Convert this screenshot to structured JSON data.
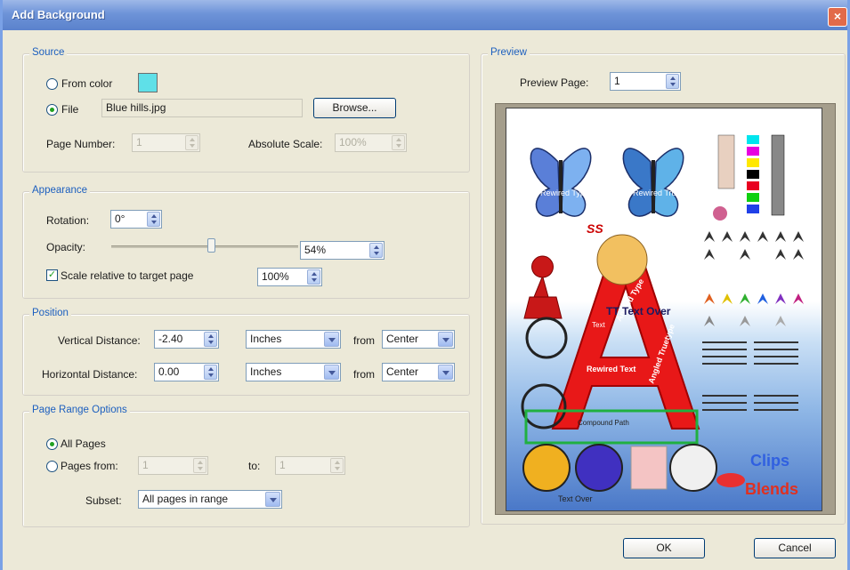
{
  "window": {
    "title": "Add Background",
    "close_glyph": "×"
  },
  "source": {
    "title": "Source",
    "from_color_label": "From color",
    "from_color_selected": false,
    "color": "#5fe0e8",
    "file_label": "File",
    "file_selected": true,
    "file_value": "Blue hills.jpg",
    "browse_label": "Browse...",
    "page_number_label": "Page Number:",
    "page_number_value": "1",
    "absolute_scale_label": "Absolute Scale:",
    "absolute_scale_value": "100%"
  },
  "appearance": {
    "title": "Appearance",
    "rotation_label": "Rotation:",
    "rotation_value": "0°",
    "opacity_label": "Opacity:",
    "opacity_value": "54%",
    "opacity_fraction": 0.54,
    "scale_checked": true,
    "scale_label": "Scale relative to target page",
    "scale_value": "100%"
  },
  "position": {
    "title": "Position",
    "vertical_label": "Vertical Distance:",
    "vertical_value": "-2.40",
    "vertical_unit": "Inches",
    "vertical_from_label": "from",
    "vertical_from": "Center",
    "horizontal_label": "Horizontal Distance:",
    "horizontal_value": "0.00",
    "horizontal_unit": "Inches",
    "horizontal_from_label": "from",
    "horizontal_from": "Center"
  },
  "page_range": {
    "title": "Page Range Options",
    "all_pages_label": "All Pages",
    "all_pages_selected": true,
    "pages_from_label": "Pages from:",
    "pages_from_value": "1",
    "to_label": "to:",
    "to_value": "1",
    "subset_label": "Subset:",
    "subset_value": "All pages in range"
  },
  "preview": {
    "title": "Preview",
    "preview_page_label": "Preview Page:",
    "preview_page_value": "1",
    "page_texts": {
      "rewired_left": "Rewired Type",
      "rewired_right": "Rewired Truetype",
      "ss": "SS",
      "angled_type": "Angled Type",
      "angled_truetype": "Angled Truetype",
      "rewired_text": "Rewired Text",
      "compound_path": "Compound Path",
      "text_over": "Text Over",
      "tt_text_over": "TT Text Over",
      "clips": "Clips",
      "blends": "Blends",
      "text": "Text"
    }
  },
  "buttons": {
    "ok": "OK",
    "cancel": "Cancel"
  }
}
